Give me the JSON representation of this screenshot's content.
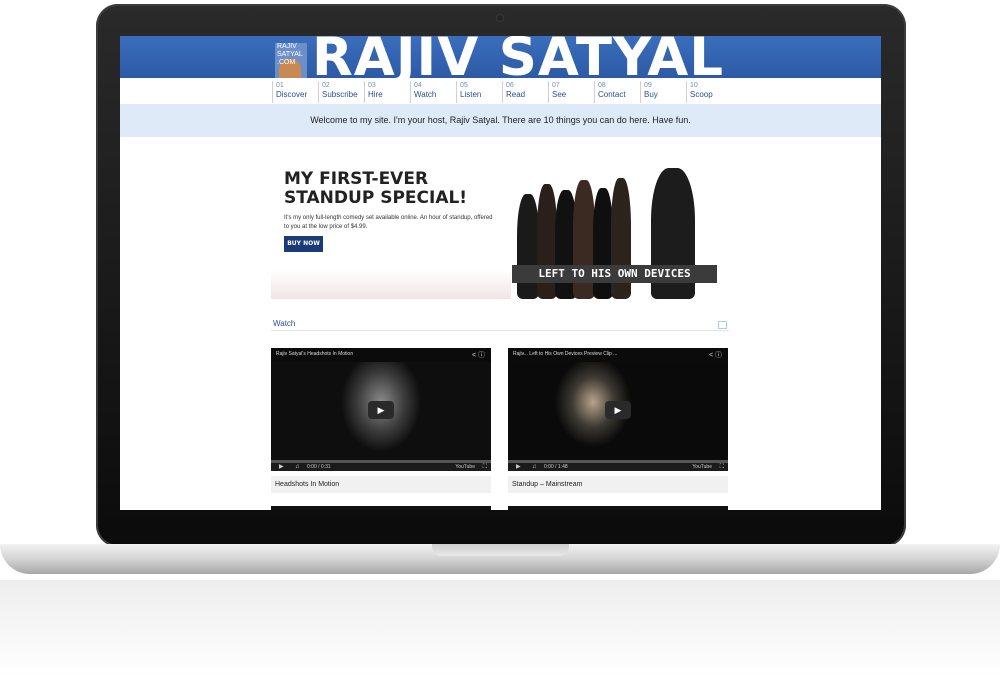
{
  "site": {
    "brand": "RAJIV SATYAL",
    "logo_lines": [
      "RAJIV",
      "SATYAL",
      ".COM"
    ],
    "nav": [
      {
        "num": "01",
        "label": "Discover"
      },
      {
        "num": "02",
        "label": "Subscribe"
      },
      {
        "num": "03",
        "label": "Hire"
      },
      {
        "num": "04",
        "label": "Watch"
      },
      {
        "num": "05",
        "label": "Listen"
      },
      {
        "num": "06",
        "label": "Read"
      },
      {
        "num": "07",
        "label": "See"
      },
      {
        "num": "08",
        "label": "Contact"
      },
      {
        "num": "09",
        "label": "Buy"
      },
      {
        "num": "10",
        "label": "Scoop"
      }
    ],
    "welcome": "Welcome to my site. I'm your host, Rajiv Satyal. There are 10 things you can do here. Have fun."
  },
  "promo": {
    "title": "MY FIRST-EVER STANDUP SPECIAL!",
    "description": "It's my only full-length comedy set available online. An hour of standup, offered to you at the low price of $4.99.",
    "buy_label": "BUY NOW",
    "cover_text": "LEFT TO HIS OWN DEVICES"
  },
  "watch": {
    "title": "Watch",
    "videos": [
      {
        "title": "Rajiv Satyal's Headshots In Motion",
        "time": "0:00 / 0:31",
        "caption": "Headshots In Motion"
      },
      {
        "title": "Rajiv... Left to His Own Devices  Preview Clip ...",
        "time": "0:00 / 1:48",
        "caption": "Standup – Mainstream"
      }
    ],
    "player_brand": "YouTube"
  },
  "icons": {
    "share": "share-icon",
    "info": "info-icon",
    "play": "play-icon",
    "volume": "volume-icon",
    "fullscreen": "fullscreen-icon",
    "settings": "settings-icon"
  },
  "colors": {
    "banner": "#2d5aa5",
    "nav_text": "#2b4f8f",
    "welcome_bg": "#deeaf8",
    "buy_button": "#1d3a78"
  }
}
